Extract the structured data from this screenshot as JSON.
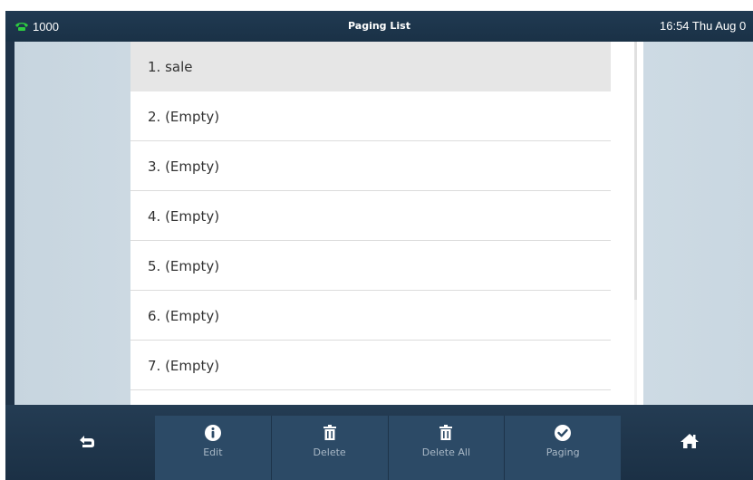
{
  "statusbar": {
    "line_label": "1000",
    "title": "Paging List",
    "datetime": "16:54 Thu Aug 0",
    "icons": {
      "line": "phone-handset-icon"
    }
  },
  "list": {
    "items": [
      {
        "label": "1. sale",
        "selected": true
      },
      {
        "label": "2. (Empty)",
        "selected": false
      },
      {
        "label": "3. (Empty)",
        "selected": false
      },
      {
        "label": "4. (Empty)",
        "selected": false
      },
      {
        "label": "5. (Empty)",
        "selected": false
      },
      {
        "label": "6. (Empty)",
        "selected": false
      },
      {
        "label": "7. (Empty)",
        "selected": false
      }
    ]
  },
  "softkeys": [
    {
      "label": "Edit",
      "icon": "info-icon"
    },
    {
      "label": "Delete",
      "icon": "trash-icon"
    },
    {
      "label": "Delete All",
      "icon": "trash-icon"
    },
    {
      "label": "Paging",
      "icon": "checkmark-circle-icon"
    }
  ],
  "side_buttons": {
    "back": {
      "icon": "back-arrow-icon"
    },
    "home": {
      "icon": "home-icon"
    }
  },
  "colors": {
    "bar_background": "#1f3348",
    "line_icon": "#2ecc40",
    "softkey_background": "#2c4a66",
    "softkey_label": "#a9b8c6",
    "selected_row": "#e6e6e6"
  }
}
